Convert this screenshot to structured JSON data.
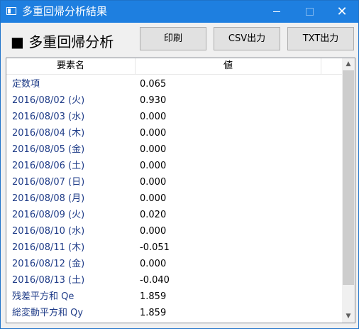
{
  "window": {
    "title": "多重回帰分析結果",
    "minimize_label": "—",
    "close_label": "✕"
  },
  "header": {
    "label": "■ 多重回帰分析"
  },
  "toolbar": {
    "print_label": "印刷",
    "csv_label": "CSV出力",
    "txt_label": "TXT出力"
  },
  "grid": {
    "columns": [
      "要素名",
      "値",
      ""
    ],
    "rows": [
      {
        "name": "定数項",
        "value": "0.065"
      },
      {
        "name": "2016/08/02 (火)",
        "value": "0.930"
      },
      {
        "name": "2016/08/03 (水)",
        "value": "0.000"
      },
      {
        "name": "2016/08/04 (木)",
        "value": "0.000"
      },
      {
        "name": "2016/08/05 (金)",
        "value": "0.000"
      },
      {
        "name": "2016/08/06 (土)",
        "value": "0.000"
      },
      {
        "name": "2016/08/07 (日)",
        "value": "0.000"
      },
      {
        "name": "2016/08/08 (月)",
        "value": "0.000"
      },
      {
        "name": "2016/08/09 (火)",
        "value": "0.020"
      },
      {
        "name": "2016/08/10 (水)",
        "value": "0.000"
      },
      {
        "name": "2016/08/11 (木)",
        "value": "-0.051"
      },
      {
        "name": "2016/08/12 (金)",
        "value": "0.000"
      },
      {
        "name": "2016/08/13 (土)",
        "value": "-0.040"
      },
      {
        "name": "残差平方和 Qe",
        "value": "1.859"
      },
      {
        "name": "総変動平方和 Qy",
        "value": "1.859"
      }
    ]
  },
  "scrollbar": {
    "up_icon": "chevron-up-icon",
    "down_icon": "chevron-down-icon"
  },
  "colors": {
    "titlebar": "#1e7fe0",
    "row_name_text": "#1f3c88"
  }
}
